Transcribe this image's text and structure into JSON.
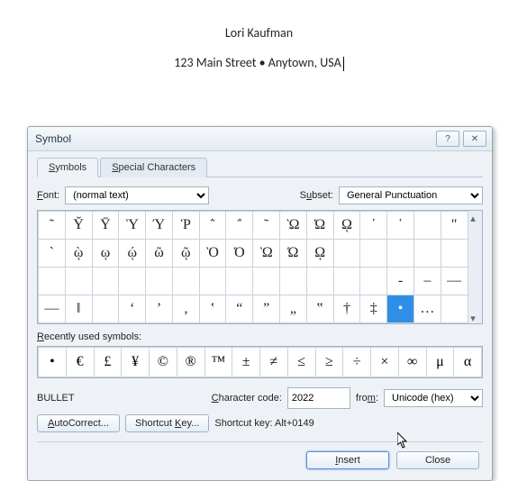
{
  "document": {
    "name": "Lori Kaufman",
    "address": "123 Main Street • Anytown, USA"
  },
  "dialog": {
    "title": "Symbol",
    "help_icon": "?",
    "close_icon": "✕",
    "tabs": {
      "symbols": "Symbols",
      "special": "Special Characters"
    },
    "font_label": "Font:",
    "font_value": "(normal text)",
    "subset_label": "Subset:",
    "subset_value": "General Punctuation",
    "grid": [
      [
        "῀",
        "Ῠ",
        "Ῡ",
        "Ὺ",
        "Ύ",
        "Ῥ",
        "῭",
        "΅",
        "῀",
        "Ὼ",
        "Ώ",
        "ῼ",
        "΄",
        "῾",
        " ",
        "\""
      ],
      [
        "`",
        "ῲ",
        "ῳ",
        "ῴ",
        "ῶ",
        "ῷ",
        "Ὸ",
        "Ό",
        "Ὼ",
        "Ώ",
        "ῼ",
        " ",
        " ",
        " ",
        " ",
        " "
      ],
      [
        " ",
        " ",
        " ",
        " ",
        " ",
        " ",
        " ",
        " ",
        " ",
        " ",
        " ",
        " ",
        " ",
        "‐",
        "–",
        "—"
      ],
      [
        "―",
        "‖",
        " ",
        "‘",
        "’",
        "‚",
        "‛",
        "“",
        "”",
        "„",
        "‟",
        "†",
        "‡",
        "•",
        "…",
        " "
      ]
    ],
    "grid_selected": {
      "row": 3,
      "col": 13
    },
    "recent_label": "Recently used symbols:",
    "recent": [
      "•",
      "€",
      "£",
      "¥",
      "©",
      "®",
      "™",
      "±",
      "≠",
      "≤",
      "≥",
      "÷",
      "×",
      "∞",
      "μ",
      "α"
    ],
    "char_name": "BULLET",
    "code_label": "Character code:",
    "code_value": "2022",
    "from_label": "from:",
    "from_value": "Unicode (hex)",
    "autocorrect": "AutoCorrect...",
    "shortcut_btn": "Shortcut Key...",
    "shortcut_label": "Shortcut key: Alt+0149",
    "insert": "Insert",
    "close": "Close"
  }
}
